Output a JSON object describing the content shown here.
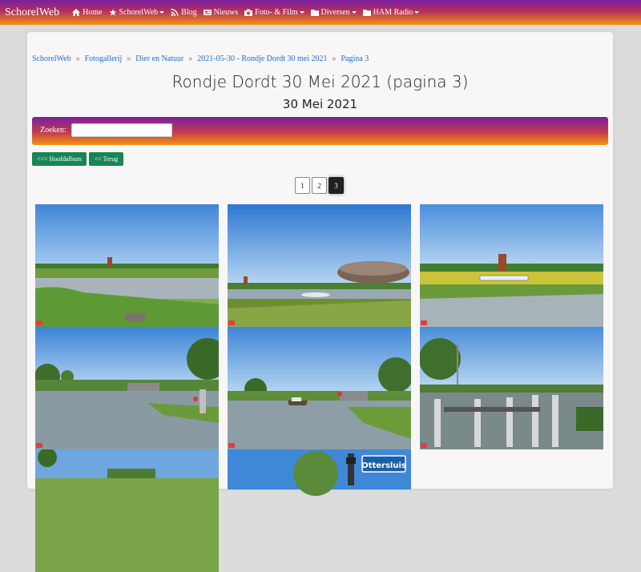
{
  "nav": {
    "brand": "SchorelWeb",
    "items": [
      {
        "label": "Home",
        "icon": "home-icon",
        "dropdown": false
      },
      {
        "label": "SchorelWeb",
        "icon": "star-icon",
        "dropdown": true
      },
      {
        "label": "Blog",
        "icon": "rss-icon",
        "dropdown": false
      },
      {
        "label": "Nieuws",
        "icon": "newspaper-icon",
        "dropdown": false
      },
      {
        "label": "Foto- & Film",
        "icon": "camera-icon",
        "dropdown": true
      },
      {
        "label": "Diversen",
        "icon": "folder-icon",
        "dropdown": true
      },
      {
        "label": "HAM Radio",
        "icon": "folder-icon",
        "dropdown": true
      }
    ]
  },
  "breadcrumb": [
    "SchorelWeb",
    "Fotogallerij",
    "Dier en Natuur",
    "2021-05-30 - Rondje Dordt 30 mei 2021",
    "Pagina 3"
  ],
  "page": {
    "title": "Rondje Dordt 30 Mei 2021 (pagina 3)",
    "subtitle": "30 Mei 2021"
  },
  "search": {
    "label": "Zoeken:",
    "value": "",
    "placeholder": ""
  },
  "buttons": {
    "main_album": "<<< Hoofdalbum",
    "back": "<< Terug"
  },
  "pagination": {
    "pages": [
      "1",
      "2",
      "3"
    ],
    "current": "3"
  },
  "gallery": {
    "photos": [
      {
        "id": "p1",
        "scene": "river-wide"
      },
      {
        "id": "p2",
        "scene": "rock-foreground"
      },
      {
        "id": "p3",
        "scene": "river-sign"
      },
      {
        "id": "p4",
        "scene": "river-trees"
      },
      {
        "id": "p5",
        "scene": "river-boat"
      },
      {
        "id": "p6",
        "scene": "lock-gate"
      },
      {
        "id": "p7",
        "scene": "partial-field"
      },
      {
        "id": "p8",
        "scene": "otter-sign",
        "sign_text": "Ottersluis"
      }
    ]
  },
  "colors": {
    "accent": "#188554",
    "link": "#1b6fd4",
    "nav_top": "#7a1fa2",
    "nav_bottom": "#f29410"
  }
}
